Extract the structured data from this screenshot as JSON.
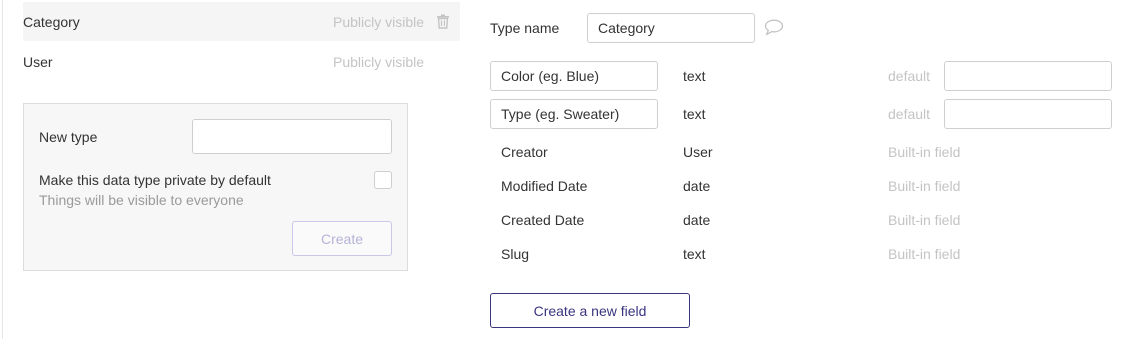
{
  "type_list": [
    {
      "name": "Category",
      "privacy": "Publicly visible",
      "selected": true
    },
    {
      "name": "User",
      "privacy": "Publicly visible",
      "selected": false
    }
  ],
  "new_type_panel": {
    "label": "New type",
    "input_value": "",
    "private_label": "Make this data type private by default",
    "private_help": "Things will be visible to everyone",
    "create_label": "Create"
  },
  "type_editor": {
    "type_name_label": "Type name",
    "type_name_value": "Category",
    "custom_fields": [
      {
        "name": "Color (eg. Blue)",
        "type": "text",
        "default_label": "default",
        "default_value": ""
      },
      {
        "name": "Type (eg. Sweater)",
        "type": "text",
        "default_label": "default",
        "default_value": ""
      }
    ],
    "builtin_fields": [
      {
        "name": "Creator",
        "type": "User",
        "note": "Built-in field"
      },
      {
        "name": "Modified Date",
        "type": "date",
        "note": "Built-in field"
      },
      {
        "name": "Created Date",
        "type": "date",
        "note": "Built-in field"
      },
      {
        "name": "Slug",
        "type": "text",
        "note": "Built-in field"
      }
    ],
    "create_field_label": "Create a new field"
  },
  "colors": {
    "accent": "#3a3580",
    "muted_text": "#c4c4c4",
    "panel_bg": "#f7f7f7"
  },
  "icons": {
    "trash": "trash-icon",
    "comment": "comment-icon"
  }
}
